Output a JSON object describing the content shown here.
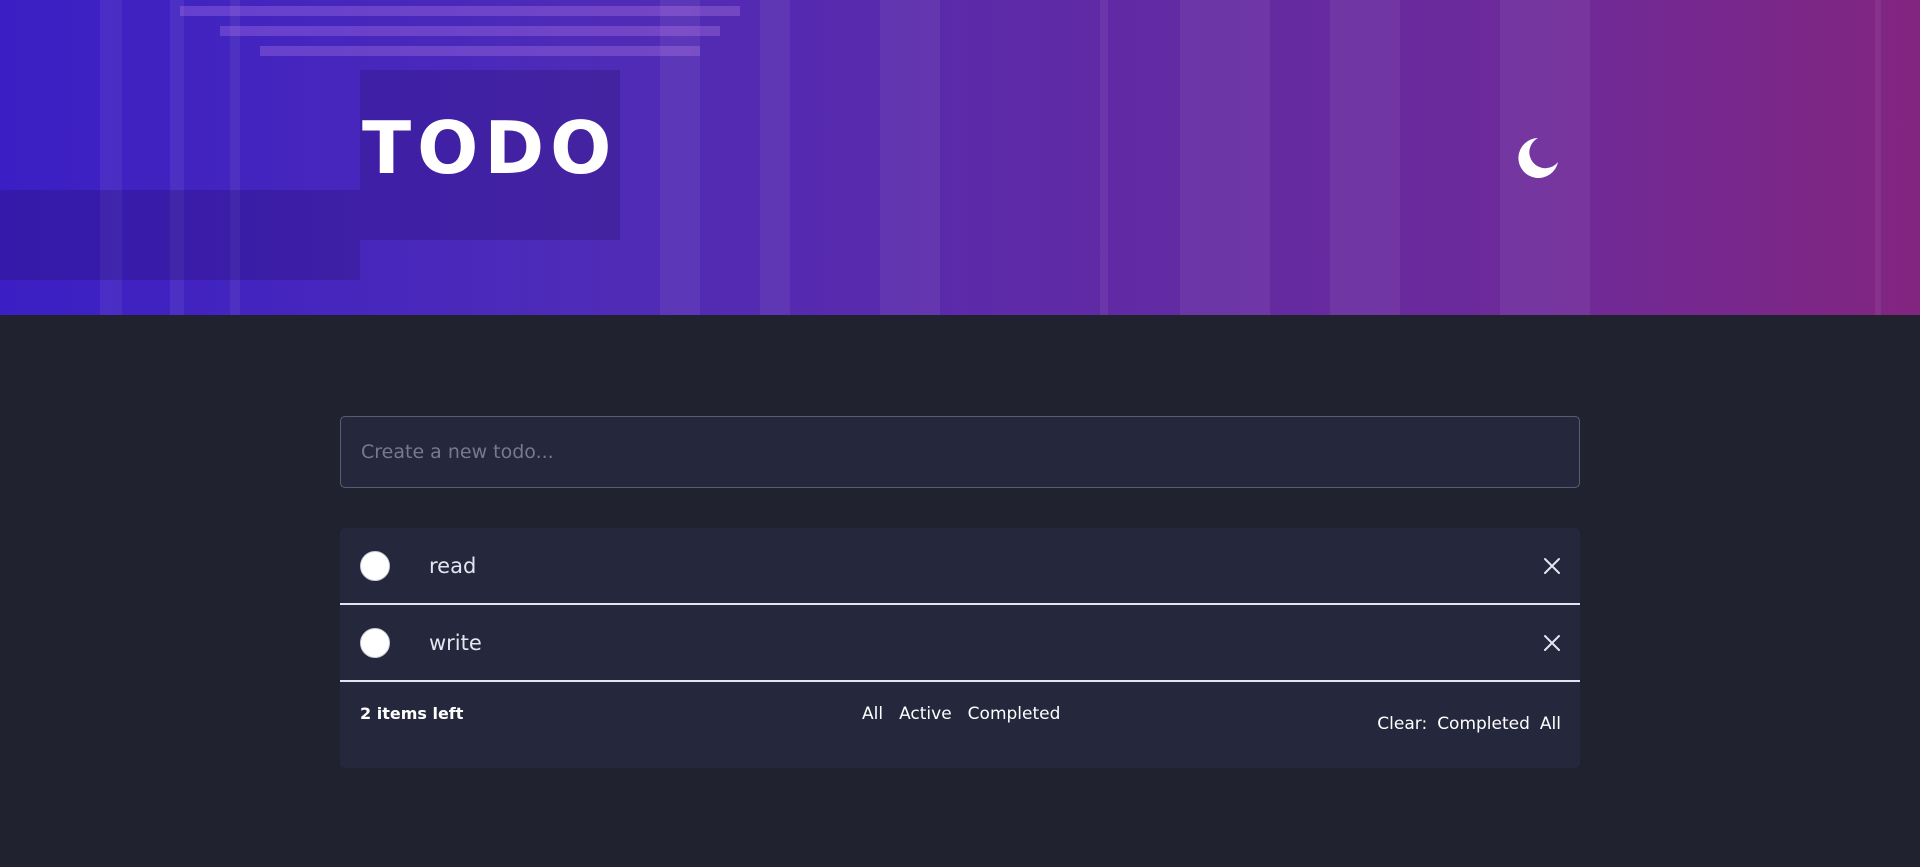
{
  "header": {
    "title": "TODO",
    "theme_icon": "moon-icon",
    "colors": {
      "gradient_start": "#3b1fc4",
      "gradient_end": "#82257f"
    }
  },
  "new_todo": {
    "placeholder": "Create a new todo..."
  },
  "todos": [
    {
      "text": "read",
      "completed": false
    },
    {
      "text": "write",
      "completed": false
    }
  ],
  "footer": {
    "items_left": "2 items left",
    "filters": [
      "All",
      "Active",
      "Completed"
    ],
    "clear_label": "Clear:",
    "clear_completed": "Completed",
    "clear_all": "All"
  },
  "colors": {
    "page_background": "#20222f",
    "panel_background": "#25273c",
    "text": "#e4e5f1"
  }
}
